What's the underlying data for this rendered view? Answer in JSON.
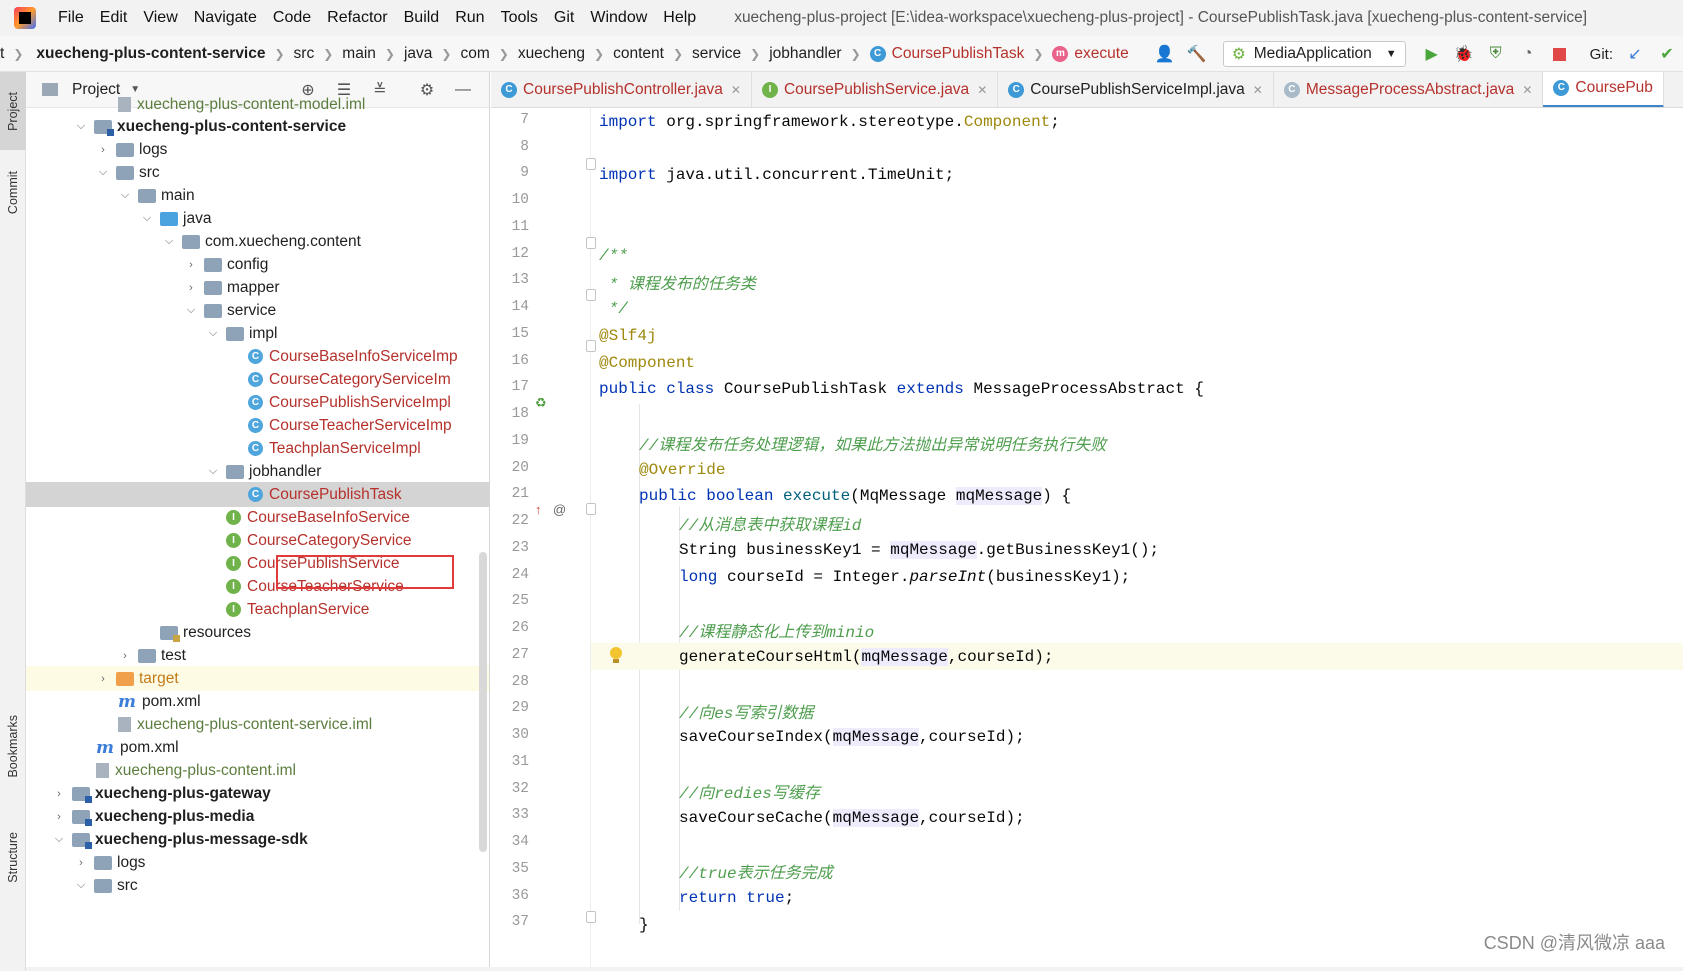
{
  "menu": {
    "items": [
      "File",
      "Edit",
      "View",
      "Navigate",
      "Code",
      "Refactor",
      "Build",
      "Run",
      "Tools",
      "Git",
      "Window",
      "Help"
    ],
    "window_title": "xuecheng-plus-project [E:\\idea-workspace\\xuecheng-plus-project] - CoursePublishTask.java [xuecheng-plus-content-service]"
  },
  "breadcrumb": {
    "lead": "t",
    "items": [
      "xuecheng-plus-content-service",
      "src",
      "main",
      "java",
      "com",
      "xuecheng",
      "content",
      "service",
      "jobhandler",
      "CoursePublishTask",
      "execute"
    ]
  },
  "toolbar": {
    "run_config": "MediaApplication",
    "git_label": "Git:"
  },
  "left_strip": {
    "project": "Project",
    "commit": "Commit",
    "bookmarks": "Bookmarks",
    "structure": "Structure"
  },
  "project_panel": {
    "title": "Project",
    "tree": [
      {
        "label": "xuecheng-plus-content-model.iml",
        "kind": "iml"
      },
      {
        "label": "xuecheng-plus-content-service",
        "kind": "module"
      },
      {
        "label": "logs",
        "kind": "folder"
      },
      {
        "label": "src",
        "kind": "folder"
      },
      {
        "label": "main",
        "kind": "folder"
      },
      {
        "label": "java",
        "kind": "folder-blue"
      },
      {
        "label": "com.xuecheng.content",
        "kind": "package"
      },
      {
        "label": "config",
        "kind": "package"
      },
      {
        "label": "mapper",
        "kind": "package"
      },
      {
        "label": "service",
        "kind": "package"
      },
      {
        "label": "impl",
        "kind": "package"
      },
      {
        "label": "CourseBaseInfoServiceImp",
        "kind": "class"
      },
      {
        "label": "CourseCategoryServiceIm",
        "kind": "class"
      },
      {
        "label": "CoursePublishServiceImpl",
        "kind": "class"
      },
      {
        "label": "CourseTeacherServiceImp",
        "kind": "class"
      },
      {
        "label": "TeachplanServiceImpl",
        "kind": "class"
      },
      {
        "label": "jobhandler",
        "kind": "package"
      },
      {
        "label": "CoursePublishTask",
        "kind": "class"
      },
      {
        "label": "CourseBaseInfoService",
        "kind": "interface"
      },
      {
        "label": "CourseCategoryService",
        "kind": "interface"
      },
      {
        "label": "CoursePublishService",
        "kind": "interface"
      },
      {
        "label": "CourseTeacherService",
        "kind": "interface"
      },
      {
        "label": "TeachplanService",
        "kind": "interface"
      },
      {
        "label": "resources",
        "kind": "resources"
      },
      {
        "label": "test",
        "kind": "folder"
      },
      {
        "label": "target",
        "kind": "folder-orange"
      },
      {
        "label": "pom.xml",
        "kind": "maven"
      },
      {
        "label": "xuecheng-plus-content-service.iml",
        "kind": "iml"
      },
      {
        "label": "pom.xml",
        "kind": "maven"
      },
      {
        "label": "xuecheng-plus-content.iml",
        "kind": "iml"
      },
      {
        "label": "xuecheng-plus-gateway",
        "kind": "module"
      },
      {
        "label": "xuecheng-plus-media",
        "kind": "module"
      },
      {
        "label": "xuecheng-plus-message-sdk",
        "kind": "module"
      },
      {
        "label": "logs",
        "kind": "folder"
      },
      {
        "label": "src",
        "kind": "folder"
      }
    ]
  },
  "editor": {
    "tabs": [
      "CoursePublishController.java",
      "CoursePublishService.java",
      "CoursePublishServiceImpl.java",
      "MessageProcessAbstract.java",
      "CoursePub"
    ],
    "line_numbers": [
      "7",
      "8",
      "9",
      "10",
      "11",
      "12",
      "13",
      "14",
      "15",
      "16",
      "17",
      "18",
      "19",
      "20",
      "21",
      "22",
      "23",
      "24",
      "25",
      "26",
      "27",
      "28",
      "29",
      "30",
      "31",
      "32",
      "33",
      "34",
      "35",
      "36",
      "37"
    ],
    "code": {
      "l7a": "import",
      "l7b": " org.springframework.stereotype.",
      "l7c": "Component",
      "l7d": ";",
      "l9a": "import",
      "l9b": " java.util.concurrent.TimeUnit;",
      "l12": "/**",
      "l13": " * 课程发布的任务类",
      "l14": " */",
      "l15": "@Slf4j",
      "l16": "@Component",
      "l17a": "public class",
      "l17b": " CoursePublishTask ",
      "l17c": "extends",
      "l17d": " MessageProcessAbstract {",
      "l19": "//课程发布任务处理逻辑，如果此方法抛出异常说明任务执行失败",
      "l20": "@Override",
      "l21a": "public boolean",
      "l21b": " execute",
      "l21c": "(MqMessage ",
      "l21d": "mqMessage",
      "l21e": ") {",
      "l22": "//从消息表中获取课程id",
      "l23a": "String businessKey1 = ",
      "l23b": "mqMessage",
      "l23c": ".getBusinessKey1();",
      "l24a": "long",
      "l24b": " courseId = Integer.",
      "l24c": "parseInt",
      "l24d": "(businessKey1);",
      "l26": "//课程静态化上传到minio",
      "l27a": "generateCourseHtml(",
      "l27b": "mqMessage",
      "l27c": ",courseId);",
      "l29": "//向es写索引数据",
      "l30a": "saveCourseIndex(",
      "l30b": "mqMessage",
      "l30c": ",courseId);",
      "l32": "//向redies写缓存",
      "l33a": "saveCourseCache(",
      "l33b": "mqMessage",
      "l33c": ",courseId);",
      "l35": "//true表示任务完成",
      "l36a": "return true",
      "l36b": ";",
      "l37": "}"
    }
  },
  "watermark": "CSDN @清风微凉 aaa",
  "colors": {
    "class_name": "#b5312c",
    "keyword": "#0033b3",
    "annotation": "#9e880d",
    "comment": "#4e9e4e",
    "highlight_box": "#e03a3a"
  }
}
